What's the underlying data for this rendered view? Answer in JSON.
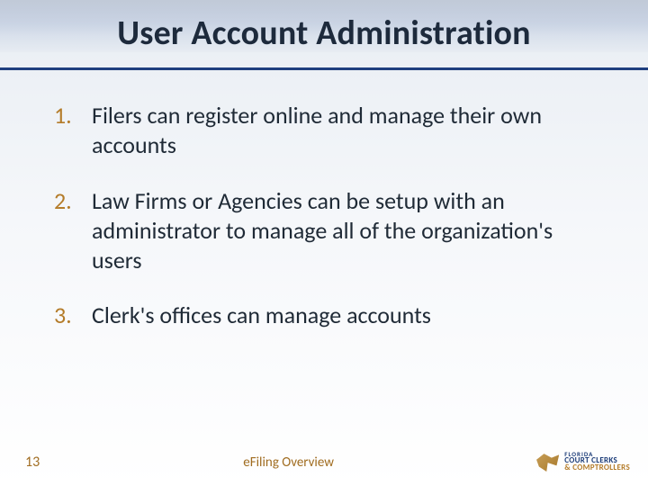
{
  "title": "User Account Administration",
  "points": [
    {
      "num": "1.",
      "text": "Filers can register online and manage their own accounts"
    },
    {
      "num": "2.",
      "text": "Law Firms or Agencies can be setup with an administrator to manage all of the organization's users"
    },
    {
      "num": "3.",
      "text": "Clerk's offices can manage accounts"
    }
  ],
  "footer": {
    "page_number": "13",
    "center_label": "eFiling Overview",
    "logo": {
      "line1": "FLORIDA",
      "line2": "COURT CLERKS",
      "line3": "& COMPTROLLERS"
    }
  }
}
